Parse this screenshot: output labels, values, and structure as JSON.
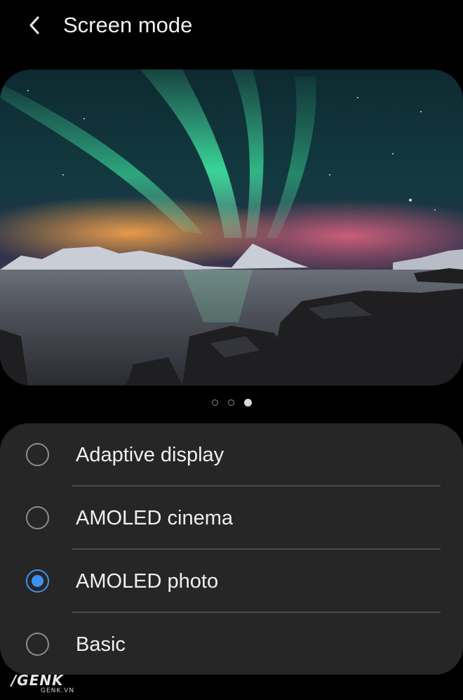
{
  "header": {
    "back_icon": "chevron-left-icon",
    "title": "Screen mode"
  },
  "preview": {
    "image": "aurora-landscape-photo",
    "pager": {
      "total": 3,
      "active_index": 2
    }
  },
  "options": [
    {
      "label": "Adaptive display",
      "selected": false
    },
    {
      "label": "AMOLED cinema",
      "selected": false
    },
    {
      "label": "AMOLED photo",
      "selected": true
    },
    {
      "label": "Basic",
      "selected": false
    }
  ],
  "colors": {
    "background": "#000000",
    "card": "#262626",
    "accent": "#3e91f2",
    "text": "#f0f0f0"
  },
  "watermark": {
    "logo": "/GENK",
    "site": "GENK.VN"
  }
}
